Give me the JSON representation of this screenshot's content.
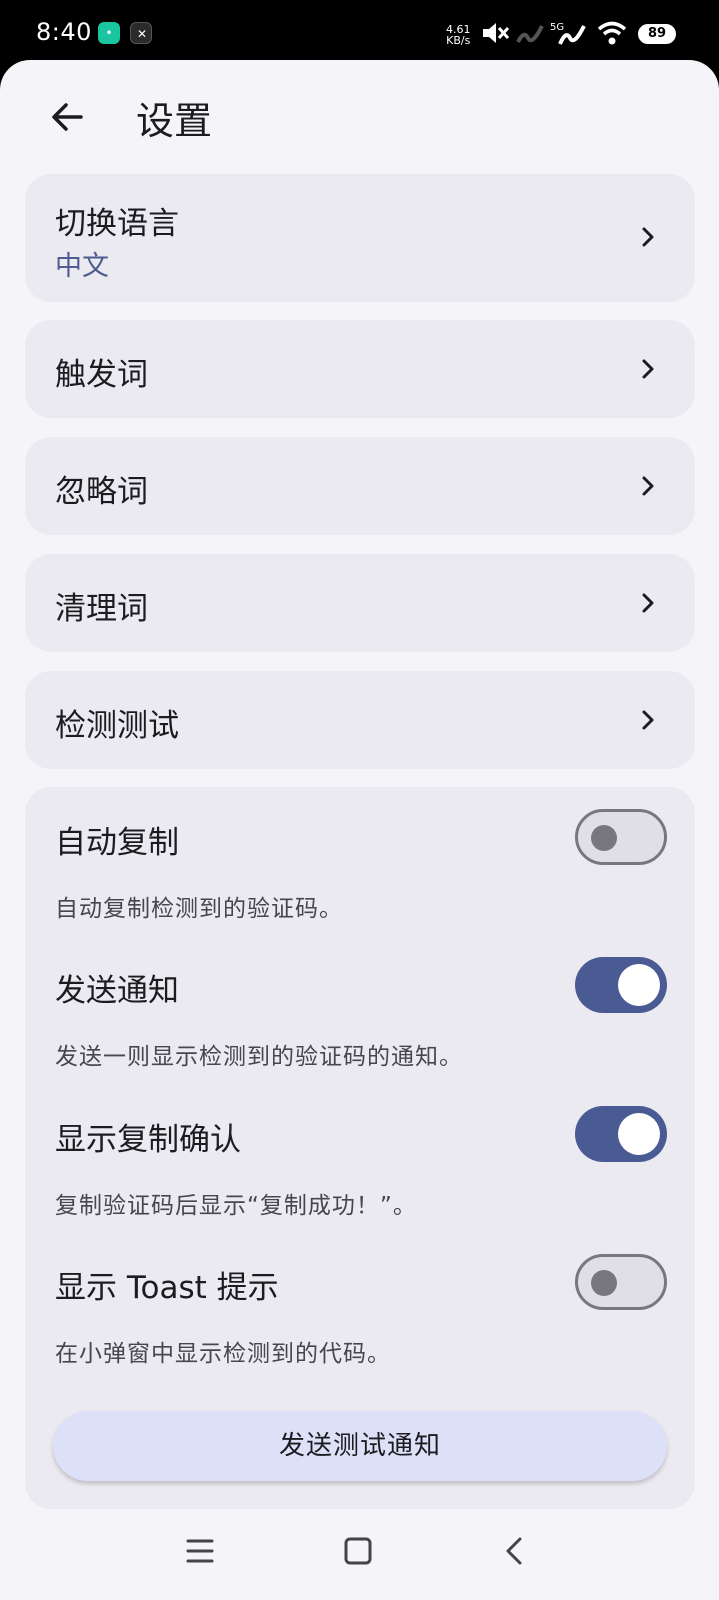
{
  "status_bar": {
    "time": "8:40",
    "net_speed_value": "4.61",
    "net_speed_unit": "KB/s",
    "signal_label": "5G",
    "battery": "89"
  },
  "header": {
    "title": "设置",
    "back_icon": "arrow-left-icon"
  },
  "nav_items": [
    {
      "label": "切换语言",
      "value": "中文"
    },
    {
      "label": "触发词"
    },
    {
      "label": "忽略词"
    },
    {
      "label": "清理词"
    },
    {
      "label": "检测测试"
    }
  ],
  "settings": [
    {
      "label": "自动复制",
      "description": "自动复制检测到的验证码。",
      "enabled": false
    },
    {
      "label": "发送通知",
      "description": "发送一则显示检测到的验证码的通知。",
      "enabled": true
    },
    {
      "label": "显示复制确认",
      "description": "复制验证码后显示“复制成功！”。",
      "enabled": true
    },
    {
      "label": "显示 Toast 提示",
      "description": "在小弹窗中显示检测到的代码。",
      "enabled": false
    }
  ],
  "test_button": {
    "label": "发送测试通知"
  },
  "colors": {
    "accent": "#4a5b93",
    "card": "#ebeaf0",
    "background": "#f5f4f9",
    "button": "#dde1f8"
  }
}
